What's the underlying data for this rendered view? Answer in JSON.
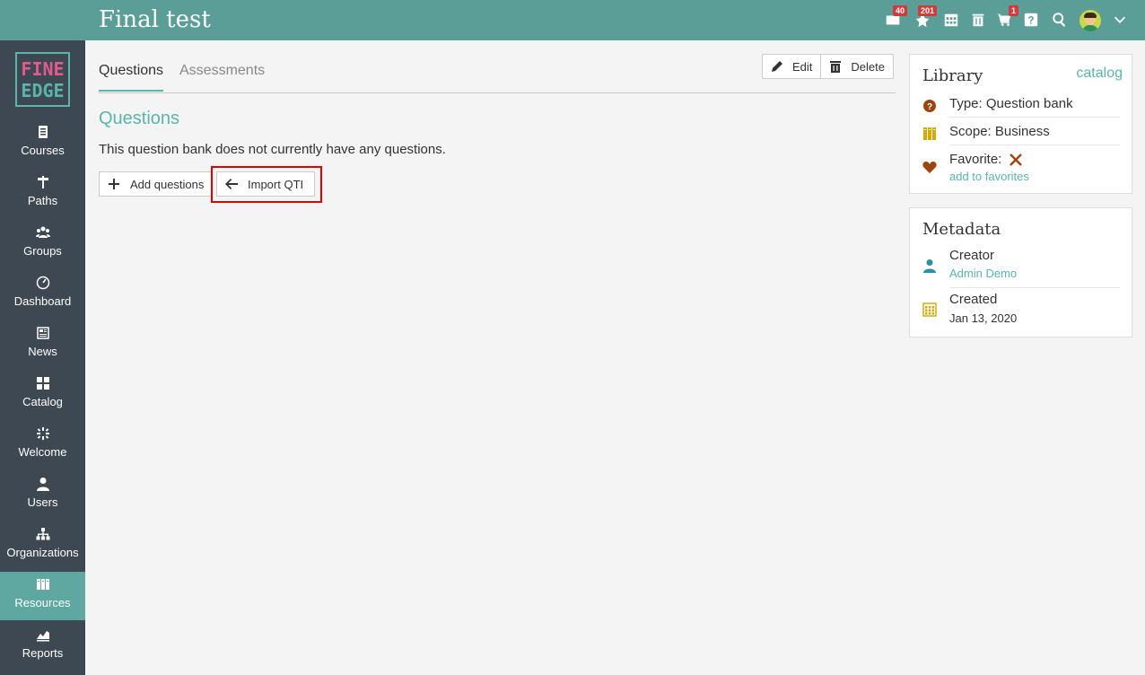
{
  "header": {
    "title": "Final test",
    "badges": {
      "messages": "40",
      "notifications": "201",
      "cart": "1"
    }
  },
  "logo": {
    "line1": "FINE",
    "line2": "EDGE"
  },
  "sidebar": {
    "items": [
      {
        "label": "Courses",
        "icon": "book-icon"
      },
      {
        "label": "Paths",
        "icon": "signpost-icon"
      },
      {
        "label": "Groups",
        "icon": "groups-icon"
      },
      {
        "label": "Dashboard",
        "icon": "gauge-icon"
      },
      {
        "label": "News",
        "icon": "newspaper-icon"
      },
      {
        "label": "Catalog",
        "icon": "grid-icon"
      },
      {
        "label": "Welcome",
        "icon": "burst-icon"
      },
      {
        "label": "Users",
        "icon": "user-icon"
      },
      {
        "label": "Organizations",
        "icon": "org-icon"
      },
      {
        "label": "Resources",
        "icon": "books-icon",
        "active": true
      },
      {
        "label": "Reports",
        "icon": "chart-icon"
      }
    ]
  },
  "tabs": [
    {
      "label": "Questions",
      "active": true
    },
    {
      "label": "Assessments",
      "active": false
    }
  ],
  "actions": {
    "edit": "Edit",
    "delete": "Delete"
  },
  "main": {
    "section_title": "Questions",
    "empty_text": "This question bank does not currently have any questions.",
    "add_label": "Add questions",
    "import_label": "Import QTI"
  },
  "library": {
    "title": "Library",
    "link": "catalog",
    "type": "Type: Question bank",
    "scope": "Scope: Business",
    "favorite": "Favorite:",
    "add_favorites": "add to favorites"
  },
  "metadata": {
    "title": "Metadata",
    "creator_label": "Creator",
    "creator_value": "Admin Demo",
    "created_label": "Created",
    "created_value": "Jan 13, 2020"
  },
  "colors": {
    "header": "#5b9e98",
    "sidebar": "#3d4852",
    "accent": "#5ab5ad",
    "badge": "#d13b3b",
    "highlight": "#e00000"
  }
}
